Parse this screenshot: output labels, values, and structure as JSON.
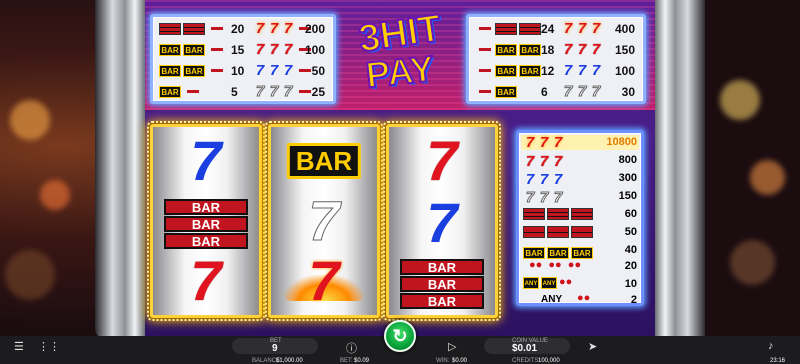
{
  "game": {
    "logo_line1": "3HIT",
    "logo_line2": "PAY"
  },
  "colors": {
    "accent_gold": "#ffd23a",
    "spin_green": "#0aa33a",
    "cabinet_purple": "#3c1c77"
  },
  "paytable_left": [
    {
      "symbols": "flame-7",
      "pay_mixed": "20",
      "pay": "200"
    },
    {
      "symbols": "red-7",
      "pay_mixed": "15",
      "pay": "100"
    },
    {
      "symbols": "blue-7",
      "pay_mixed": "10",
      "pay": "50"
    },
    {
      "symbols": "white-7",
      "pay_mixed": "5",
      "pay": "25"
    }
  ],
  "paytable_right": [
    {
      "symbols": "flame-7",
      "pay_mixed": "24",
      "pay": "400"
    },
    {
      "symbols": "red-7",
      "pay_mixed": "18",
      "pay": "150"
    },
    {
      "symbols": "blue-7",
      "pay_mixed": "12",
      "pay": "100"
    },
    {
      "symbols": "white-7",
      "pay_mixed": "6",
      "pay": "30"
    }
  ],
  "paytable_side": [
    {
      "symbols": "flame-7 x3",
      "pay": "10800"
    },
    {
      "symbols": "red-7 x3",
      "pay": "800"
    },
    {
      "symbols": "blue-7 x3",
      "pay": "300"
    },
    {
      "symbols": "white-7 x3",
      "pay": "150"
    },
    {
      "symbols": "triple-bar x3",
      "pay": "60"
    },
    {
      "symbols": "double-bar x3",
      "pay": "50"
    },
    {
      "symbols": "single-bar x3",
      "pay": "40"
    },
    {
      "symbols": "cherry x3",
      "pay": "20"
    },
    {
      "symbols": "any-bar any-bar cherry",
      "pay": "10"
    },
    {
      "symbols": "any cherry",
      "pay": "2",
      "label": "ANY"
    }
  ],
  "reels": {
    "reel1": [
      "blue-7",
      "triple-bar",
      "red-7"
    ],
    "reel2": [
      "single-bar",
      "white-7",
      "flame-7"
    ],
    "reel3": [
      "red-7",
      "blue-7",
      "triple-bar"
    ],
    "bar_text": "BAR"
  },
  "bottom": {
    "bet_label": "BET",
    "bet_value": "9",
    "coin_value_label": "COIN VALUE",
    "coin_value": "$0.01",
    "balance_label": "BALANCE:",
    "balance_value": "$1,000.00",
    "bet_small_label": "BET:",
    "bet_small_value": "$0.09",
    "win_label": "WIN:",
    "win_value": "$0.00",
    "credits_label": "CREDITS:",
    "credits_value": "100,000",
    "time": "23:16"
  }
}
